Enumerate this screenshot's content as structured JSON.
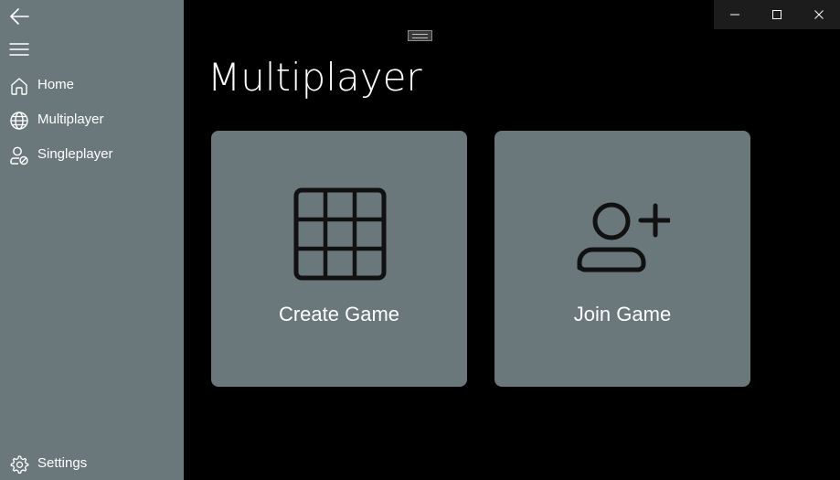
{
  "sidebar": {
    "back_icon": "back-arrow-icon",
    "menu_icon": "hamburger-menu-icon",
    "items": [
      {
        "label": "Home",
        "icon": "home-icon"
      },
      {
        "label": "Multiplayer",
        "icon": "globe-icon"
      },
      {
        "label": "Singleplayer",
        "icon": "person-icon"
      }
    ],
    "footer": {
      "label": "Settings",
      "icon": "gear-icon"
    }
  },
  "window_controls": {
    "minimize_icon": "minimize-icon",
    "maximize_icon": "maximize-icon",
    "close_icon": "close-icon"
  },
  "page": {
    "title": "Multiplayer"
  },
  "cards": [
    {
      "label": "Create Game",
      "icon": "grid-icon"
    },
    {
      "label": "Join Game",
      "icon": "add-person-icon"
    }
  ],
  "colors": {
    "sidebar_bg": "#6b787b",
    "card_bg": "#6b787b",
    "page_bg": "#000000",
    "text": "#ffffff",
    "icon_dark": "#111111"
  }
}
